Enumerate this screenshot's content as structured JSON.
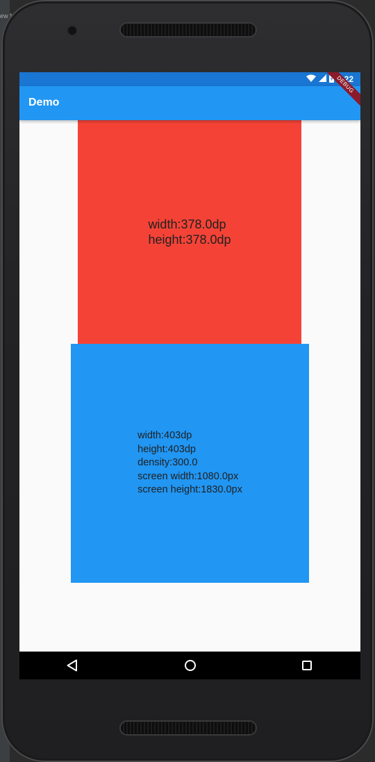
{
  "host": {
    "fragment": "ew N"
  },
  "status_bar": {
    "time": "6:22"
  },
  "app_bar": {
    "title": "Demo",
    "debug_banner": "DEBUG"
  },
  "red_box": {
    "lines": [
      "width:378.0dp",
      "height:378.0dp"
    ]
  },
  "blue_box": {
    "lines": [
      "width:403dp",
      "height:403dp",
      "density:300.0",
      "screen width:1080.0px",
      "screen height:1830.0px"
    ]
  },
  "nav_bar": {
    "icons": [
      "back-icon",
      "home-icon",
      "recent-apps-icon"
    ]
  },
  "colors": {
    "status_bar": "#1976d2",
    "app_bar": "#2196f3",
    "red_box": "#f44336",
    "blue_box": "#2196f3",
    "background": "#fafafa",
    "nav_bar": "#000000"
  }
}
